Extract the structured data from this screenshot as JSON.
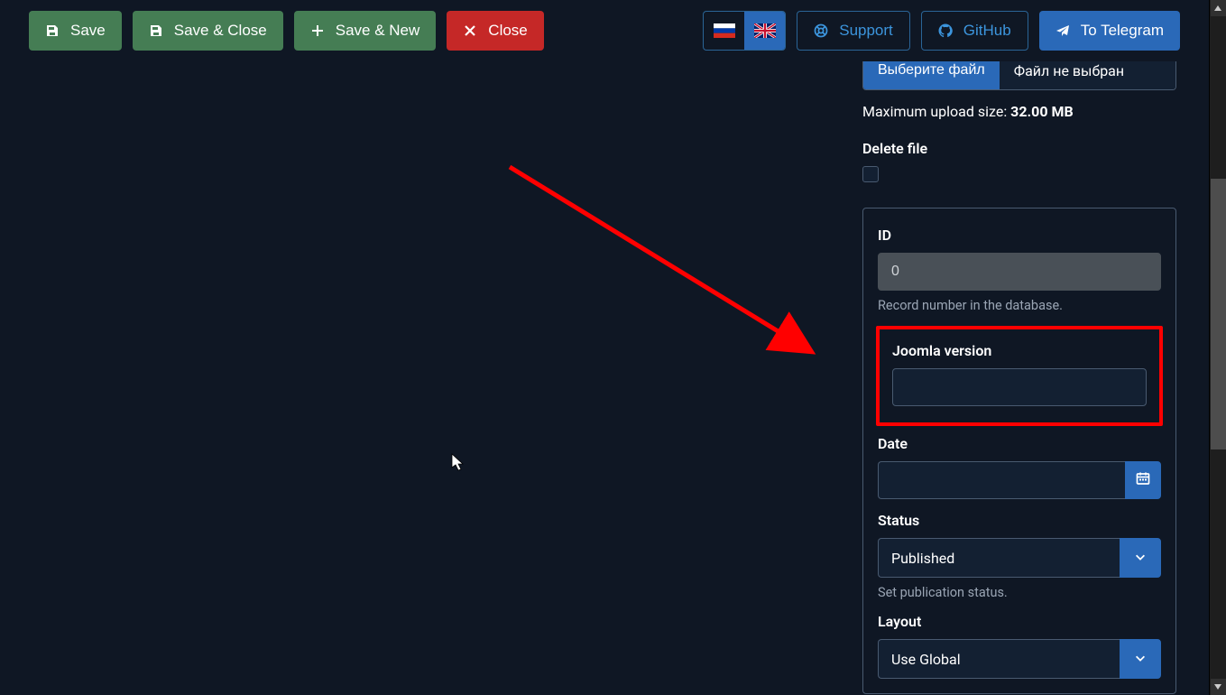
{
  "toolbar": {
    "save": "Save",
    "save_close": "Save & Close",
    "save_new": "Save & New",
    "close": "Close",
    "support": "Support",
    "github": "GitHub",
    "telegram": "To Telegram"
  },
  "file_panel": {
    "choose_label": "Выберите файл",
    "no_file": "Файл не выбран",
    "max_upload_label": "Maximum upload size: ",
    "max_upload_value": "32.00 MB",
    "delete_label": "Delete file"
  },
  "fields": {
    "id_label": "ID",
    "id_value": "0",
    "id_help": "Record number in the database.",
    "joomla_label": "Joomla version",
    "joomla_value": "",
    "date_label": "Date",
    "date_value": "",
    "status_label": "Status",
    "status_value": "Published",
    "status_help": "Set publication status.",
    "layout_label": "Layout",
    "layout_value": "Use Global"
  }
}
